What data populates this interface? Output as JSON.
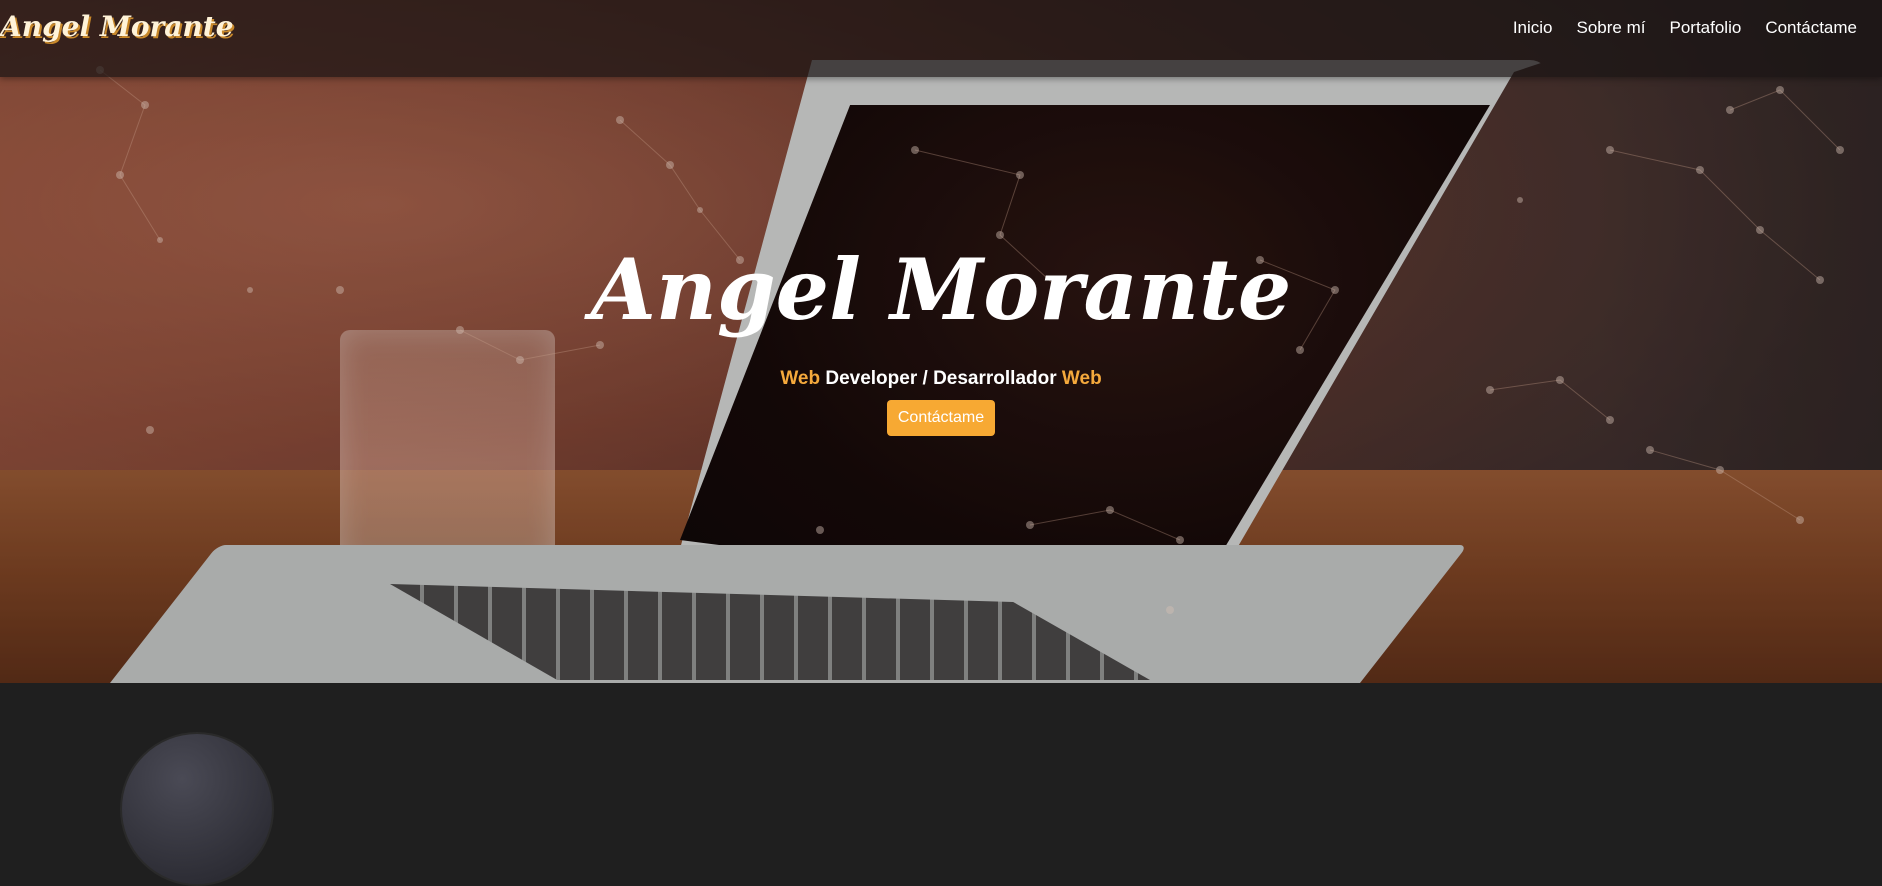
{
  "brand": {
    "name": "Angel Morante"
  },
  "nav": {
    "items": [
      "Inicio",
      "Sobre mí",
      "Portafolio",
      "Contáctame"
    ]
  },
  "hero": {
    "title": "Angel Morante",
    "subtitle": {
      "part1": "Web",
      "part2": " Developer / Desarrollador ",
      "part3": "Web"
    },
    "cta_label": "Contáctame"
  },
  "colors": {
    "accent": "#f7a933",
    "navbar": "#1a1414",
    "section_bg": "#1f1f1f"
  }
}
